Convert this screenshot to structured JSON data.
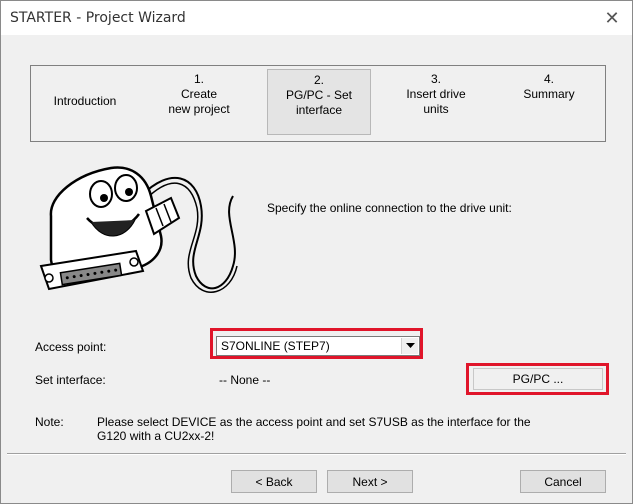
{
  "window": {
    "title": "STARTER - Project Wizard",
    "close_icon": "close-icon"
  },
  "steps": [
    {
      "line1": "Introduction",
      "line2": "",
      "line3": "",
      "active": false
    },
    {
      "line1": "1.",
      "line2": "Create",
      "line3": "new project",
      "active": false
    },
    {
      "line1": "2.",
      "line2": "PG/PC - Set",
      "line3": "interface",
      "active": true
    },
    {
      "line1": "3.",
      "line2": "Insert drive",
      "line3": "units",
      "active": false
    },
    {
      "line1": "4.",
      "line2": "Summary",
      "line3": "",
      "active": false
    }
  ],
  "main": {
    "instruction": "Specify the online connection to the drive unit:",
    "access_point_label": "Access point:",
    "access_point_value": "S7ONLINE (STEP7)",
    "set_interface_label": "Set interface:",
    "set_interface_value": "-- None --",
    "pgpc_button": "PG/PC ...",
    "note_label": "Note:",
    "note_text": "Please select DEVICE as the access point and set S7USB as the interface for the G120 with a CU2xx-2!"
  },
  "footer": {
    "back_label": "< Back",
    "next_label": "Next >",
    "cancel_label": "Cancel"
  },
  "colors": {
    "highlight": "#e0152a",
    "dialog_bg": "#f0f0f0"
  }
}
